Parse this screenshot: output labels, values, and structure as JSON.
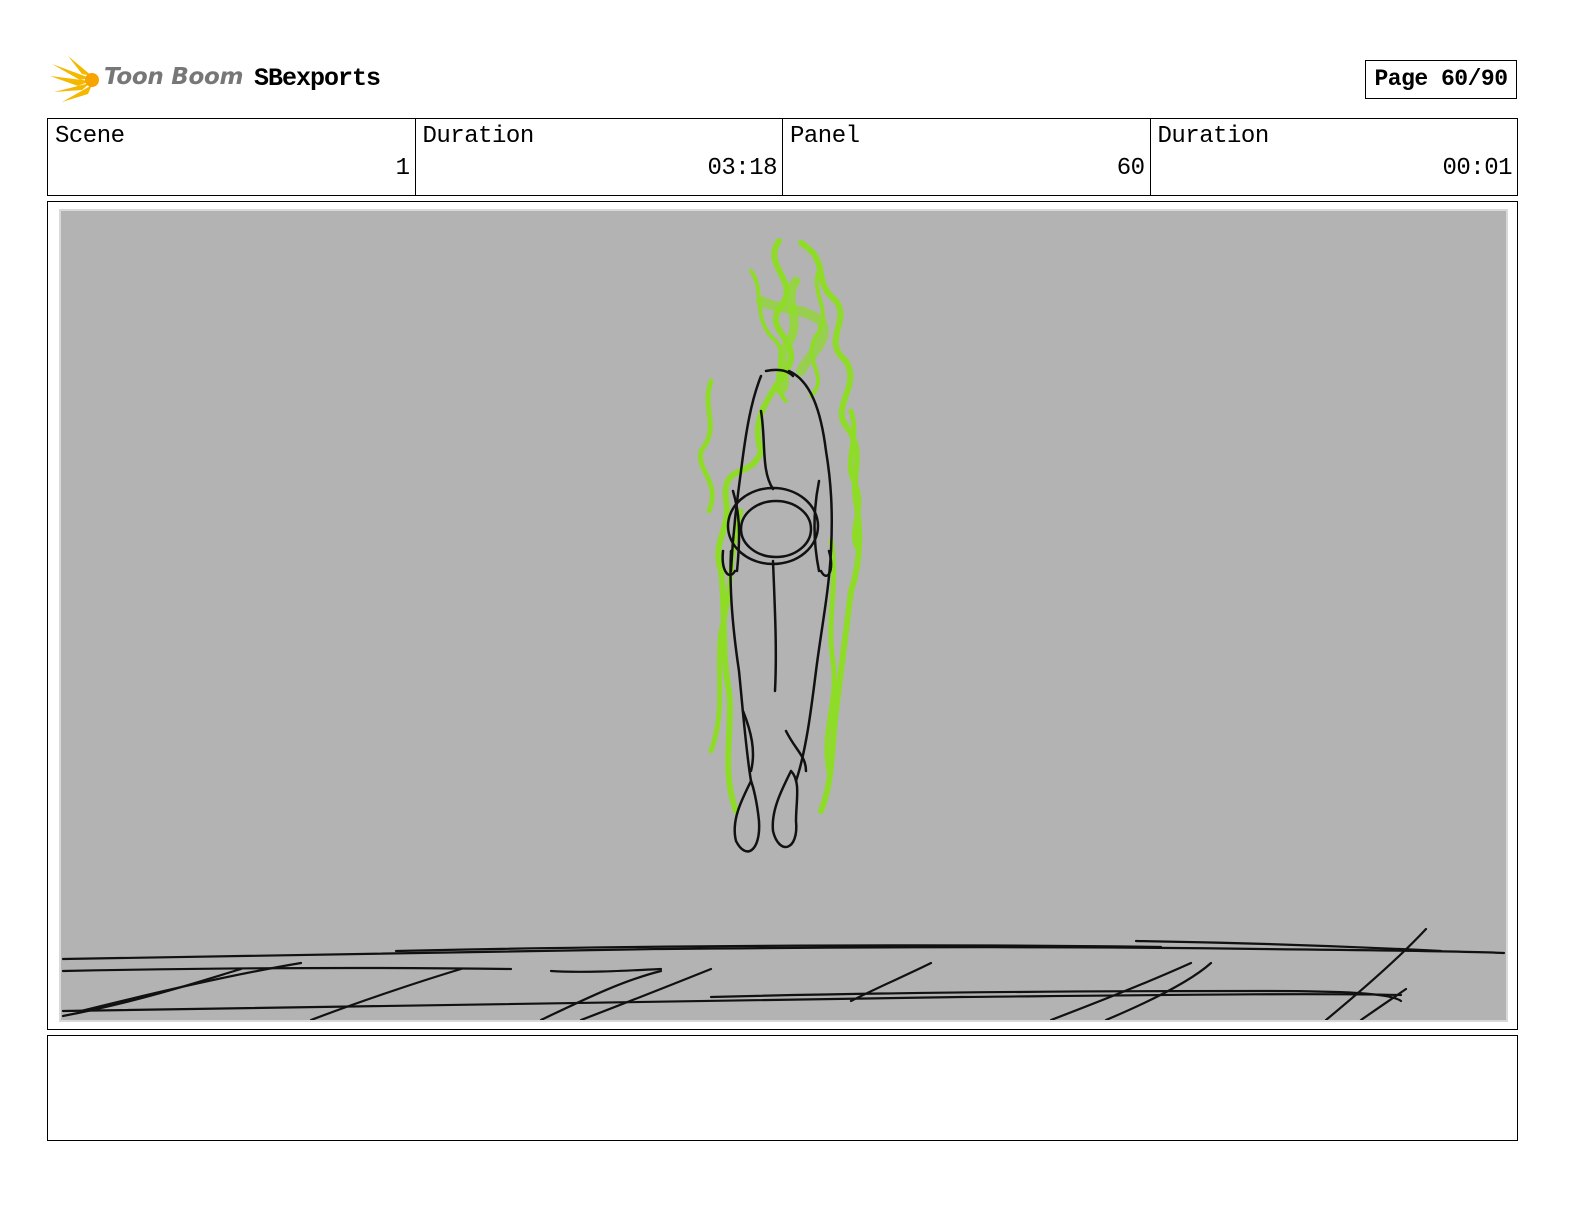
{
  "header": {
    "logo_text": "Toon Boom",
    "project_name": "SBexports",
    "page_indicator": "Page 60/90"
  },
  "info": {
    "scene_label": "Scene",
    "scene_value": "1",
    "scene_duration_label": "Duration",
    "scene_duration_value": "03:18",
    "panel_label": "Panel",
    "panel_value": "60",
    "panel_duration_label": "Duration",
    "panel_duration_value": "00:01"
  },
  "panel": {
    "background_color": "#b3b3b3",
    "glow_color": "#8fdc28",
    "sketch_color": "#111111"
  },
  "notes": {
    "text": ""
  }
}
